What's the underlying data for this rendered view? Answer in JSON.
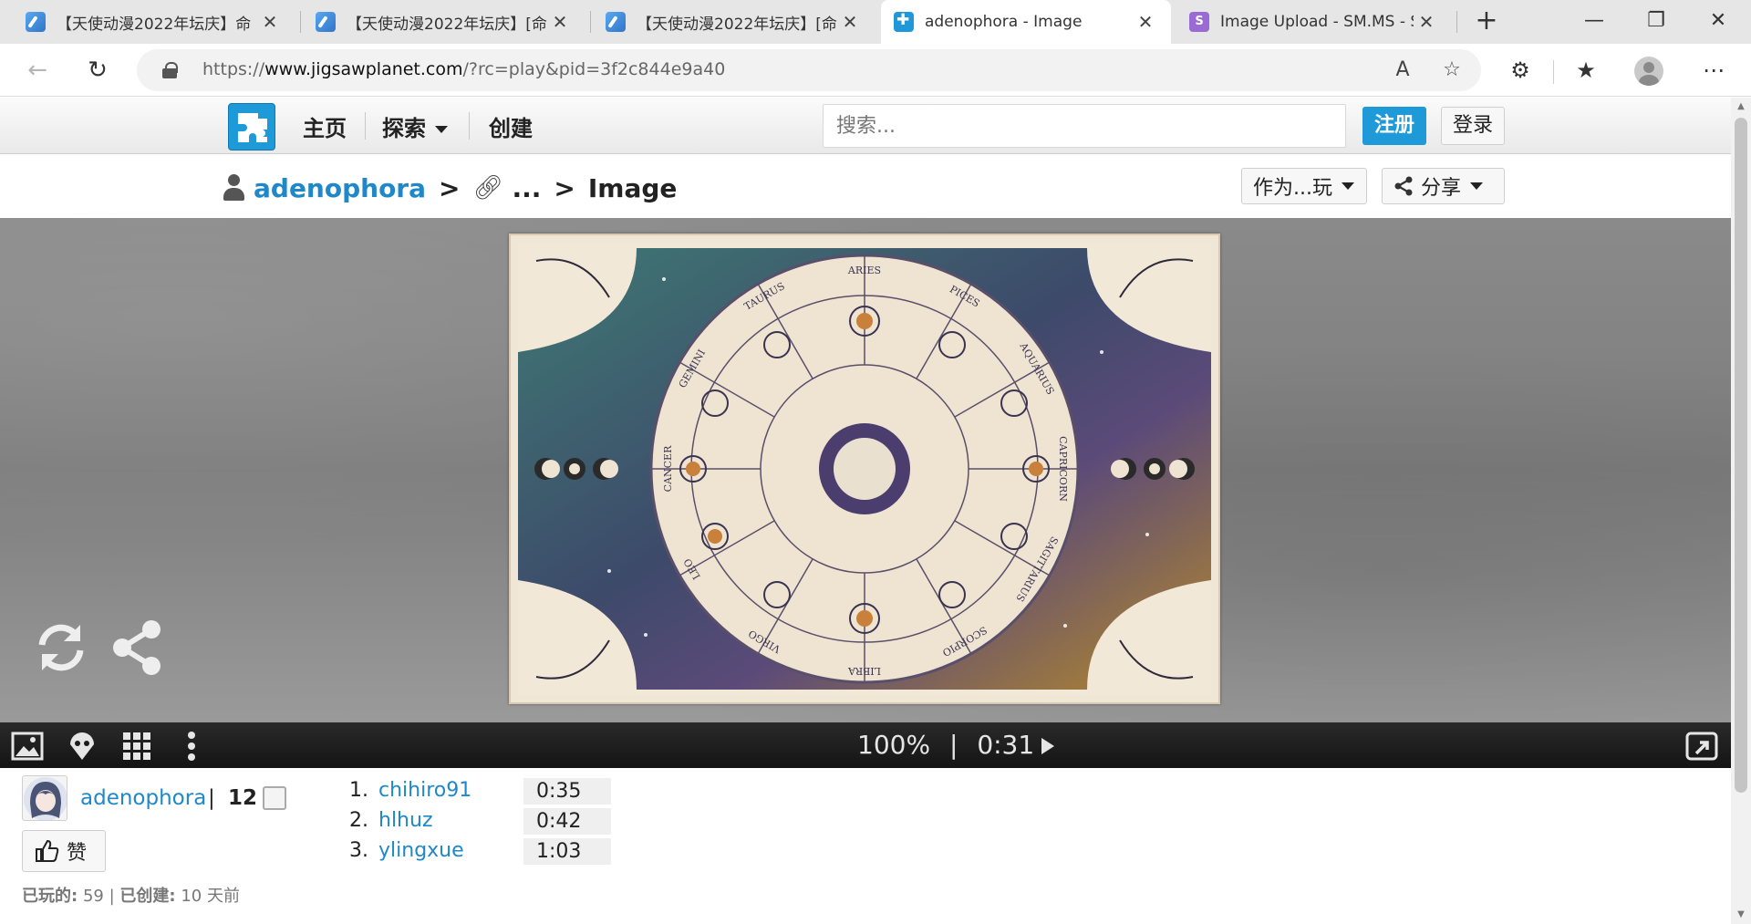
{
  "browser": {
    "tabs": [
      {
        "title": "【天使动漫2022年坛庆】命",
        "favicon": "pen-icon",
        "active": false
      },
      {
        "title": "【天使动漫2022年坛庆】[命",
        "favicon": "pen-icon",
        "active": false
      },
      {
        "title": "【天使动漫2022年坛庆】[命",
        "favicon": "pen-icon",
        "active": false
      },
      {
        "title": "adenophora - Image",
        "favicon": "jigsaw-icon",
        "active": true
      },
      {
        "title": "Image Upload - SM.MS - Si",
        "favicon": "smms-icon",
        "active": false
      }
    ],
    "url_prefix": "https://",
    "url_domain": "www.jigsawplanet.com",
    "url_path": "/?rc=play&pid=3f2c844e9a40"
  },
  "site": {
    "nav": {
      "home": "主页",
      "explore": "探索",
      "create": "创建"
    },
    "search_placeholder": "搜索...",
    "register": "注册",
    "login": "登录"
  },
  "breadcrumb": {
    "user": "adenophora",
    "sep1": ">",
    "ellipsis": "...",
    "sep2": ">",
    "title": "Image"
  },
  "actions": {
    "play_as": "作为...玩",
    "share": "分享"
  },
  "puzzle_art": {
    "signs": [
      "ARIES",
      "PICES",
      "AQUARIUS",
      "CAPRICORN",
      "SAGITTARIUS",
      "SCORPIO",
      "LIBRA",
      "VIRGO",
      "LEO",
      "CANCER",
      "GEMINI",
      "TAURUS"
    ]
  },
  "puzzle_toolbar": {
    "zoom": "100%",
    "divider": "|",
    "time": "0:31"
  },
  "author": {
    "name": "adenophora",
    "divider": "|",
    "count": "12"
  },
  "like_label": "赞",
  "leaderboard": [
    {
      "rank": "1.",
      "name": "chihiro91",
      "time": "0:35"
    },
    {
      "rank": "2.",
      "name": "hlhuz",
      "time": "0:42"
    },
    {
      "rank": "3.",
      "name": "ylingxue",
      "time": "1:03"
    }
  ],
  "stats": {
    "played_label": "已玩的:",
    "played_value": "59",
    "sep": "|",
    "created_label": "已创建:",
    "created_value": "10 天前"
  },
  "colors": {
    "brand_blue": "#1e9ad8",
    "link_blue": "#1e88c8",
    "toolbar_dark": "#1c1c1c"
  }
}
